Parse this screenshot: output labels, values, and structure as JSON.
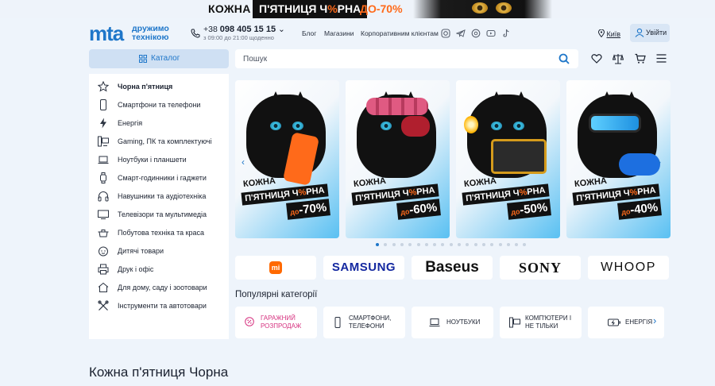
{
  "promo": {
    "part1": "КОЖНА",
    "part2a": "П'ЯТНИЦЯ Ч",
    "part2b": "%",
    "part2c": "РНА",
    "part3": "ДО-70%"
  },
  "header": {
    "logo": "mta",
    "logo_sub1": "дружимо",
    "logo_sub2": "технікою",
    "phone_prefix": "+38",
    "phone": "098 405 15 15",
    "phone_caret": "⌄",
    "hours": "з 09:00 до 21:00 щоденно",
    "nav": [
      "Блог",
      "Магазини",
      "Корпоративним клієнтам"
    ],
    "city": "Київ",
    "login": "Увійти"
  },
  "toolbar": {
    "catalog_label": "Каталог",
    "search_placeholder": "Пошук"
  },
  "sidebar": {
    "items": [
      {
        "label": "Чорна п'ятниця",
        "icon": "star-icon"
      },
      {
        "label": "Смартфони та телефони",
        "icon": "smartphone-icon"
      },
      {
        "label": "Енергія",
        "icon": "lightning-icon"
      },
      {
        "label": "Gaming, ПК та комплектуючі",
        "icon": "pc-icon"
      },
      {
        "label": "Ноутбуки і планшети",
        "icon": "laptop-icon"
      },
      {
        "label": "Смарт-годинники і гаджети",
        "icon": "watch-icon"
      },
      {
        "label": "Навушники та аудіотехніка",
        "icon": "headphones-icon"
      },
      {
        "label": "Телевізори та мультимедіа",
        "icon": "tv-icon"
      },
      {
        "label": "Побутова техніка та краса",
        "icon": "appliance-icon"
      },
      {
        "label": "Дитячі товари",
        "icon": "baby-icon"
      },
      {
        "label": "Друк і офіс",
        "icon": "printer-icon"
      },
      {
        "label": "Для дому, саду і зоотовари",
        "icon": "home-icon"
      },
      {
        "label": "Інструменти та автотовари",
        "icon": "tools-icon"
      }
    ]
  },
  "carousel": {
    "slides": [
      {
        "line1": "КОЖНА",
        "line2a": "П'ЯТНИЦЯ Ч",
        "line2b": "%",
        "line2c": "РНА",
        "minus": "до",
        "discount": "-70%"
      },
      {
        "line1": "КОЖНА",
        "line2a": "П'ЯТНИЦЯ Ч",
        "line2b": "%",
        "line2c": "РНА",
        "minus": "до",
        "discount": "-60%"
      },
      {
        "line1": "КОЖНА",
        "line2a": "П'ЯТНИЦЯ Ч",
        "line2b": "%",
        "line2c": "РНА",
        "minus": "до",
        "discount": "-50%"
      },
      {
        "line1": "КОЖНА",
        "line2a": "П'ЯТНИЦЯ Ч",
        "line2b": "%",
        "line2c": "РНА",
        "minus": "до",
        "discount": "-40%"
      }
    ],
    "dots_total": 19,
    "dots_active": 1,
    "prev": "‹",
    "next": "›"
  },
  "brands": [
    "mi",
    "SAMSUNG",
    "Baseus",
    "SONY",
    "WHOOP"
  ],
  "popular": {
    "title": "Популярні категорії",
    "items": [
      {
        "line1": "ГАРАЖНИЙ",
        "line2": "РОЗПРОДАЖ"
      },
      {
        "line1": "СМАРТФОНИ,",
        "line2": "ТЕЛЕФОНИ"
      },
      {
        "line1": "НОУТБУКИ",
        "line2": ""
      },
      {
        "line1": "КОМП'ЮТЕРИ І",
        "line2": "НЕ ТІЛЬКИ"
      },
      {
        "line1": "ЕНЕРГІЯ",
        "line2": ""
      }
    ],
    "next": "›"
  },
  "section": {
    "title": "Кожна п'ятниця Чорна"
  },
  "colors": {
    "accent": "#1e76c9",
    "orange": "#ff6a1a",
    "background": "#eef4fb",
    "pink": "#d6317f"
  }
}
